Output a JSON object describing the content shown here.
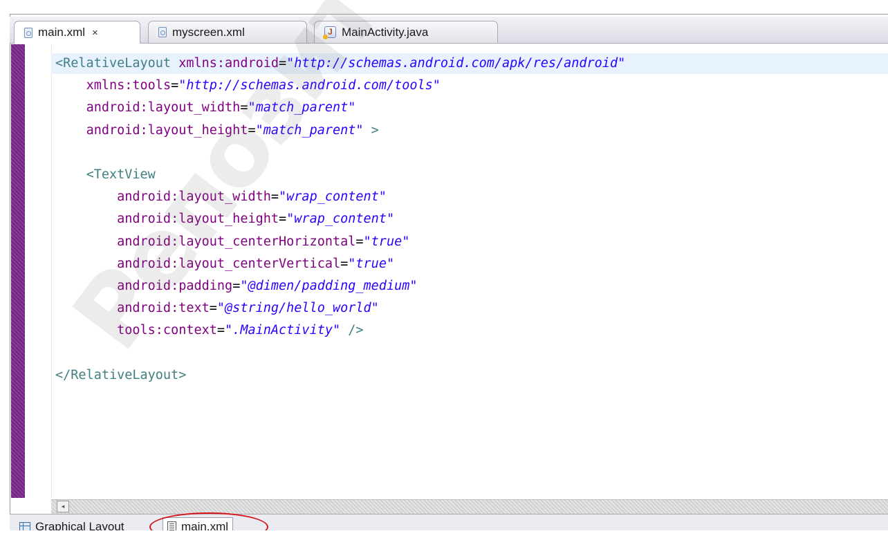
{
  "editor_tabs": [
    {
      "label": "main.xml",
      "icon": "xml-file-icon",
      "active": true,
      "close": "×"
    },
    {
      "label": "myscreen.xml",
      "icon": "xml-file-icon",
      "active": false
    },
    {
      "label": "MainActivity.java",
      "icon": "java-file-icon",
      "active": false
    }
  ],
  "code_lines": [
    [
      {
        "t": "tag",
        "v": "<RelativeLayout "
      },
      {
        "t": "attr",
        "v": "xmlns:android"
      },
      {
        "t": "eq",
        "v": "="
      },
      {
        "t": "val",
        "v": "\"http://schemas.android.com/apk/res/android\""
      }
    ],
    [
      {
        "t": "plain",
        "v": "    "
      },
      {
        "t": "attr",
        "v": "xmlns:tools"
      },
      {
        "t": "eq",
        "v": "="
      },
      {
        "t": "val",
        "v": "\"http://schemas.android.com/tools\""
      }
    ],
    [
      {
        "t": "plain",
        "v": "    "
      },
      {
        "t": "attr",
        "v": "android:layout_width"
      },
      {
        "t": "eq",
        "v": "="
      },
      {
        "t": "val",
        "v": "\"match_parent\""
      }
    ],
    [
      {
        "t": "plain",
        "v": "    "
      },
      {
        "t": "attr",
        "v": "android:layout_height"
      },
      {
        "t": "eq",
        "v": "="
      },
      {
        "t": "val",
        "v": "\"match_parent\""
      },
      {
        "t": "tag",
        "v": " >"
      }
    ],
    [],
    [
      {
        "t": "plain",
        "v": "    "
      },
      {
        "t": "tag",
        "v": "<TextView"
      }
    ],
    [
      {
        "t": "plain",
        "v": "        "
      },
      {
        "t": "attr",
        "v": "android:layout_width"
      },
      {
        "t": "eq",
        "v": "="
      },
      {
        "t": "val",
        "v": "\"wrap_content\""
      }
    ],
    [
      {
        "t": "plain",
        "v": "        "
      },
      {
        "t": "attr",
        "v": "android:layout_height"
      },
      {
        "t": "eq",
        "v": "="
      },
      {
        "t": "val",
        "v": "\"wrap_content\""
      }
    ],
    [
      {
        "t": "plain",
        "v": "        "
      },
      {
        "t": "attr",
        "v": "android:layout_centerHorizontal"
      },
      {
        "t": "eq",
        "v": "="
      },
      {
        "t": "val",
        "v": "\"true\""
      }
    ],
    [
      {
        "t": "plain",
        "v": "        "
      },
      {
        "t": "attr",
        "v": "android:layout_centerVertical"
      },
      {
        "t": "eq",
        "v": "="
      },
      {
        "t": "val",
        "v": "\"true\""
      }
    ],
    [
      {
        "t": "plain",
        "v": "        "
      },
      {
        "t": "attr",
        "v": "android:padding"
      },
      {
        "t": "eq",
        "v": "="
      },
      {
        "t": "val",
        "v": "\"@dimen/padding_medium\""
      }
    ],
    [
      {
        "t": "plain",
        "v": "        "
      },
      {
        "t": "attr",
        "v": "android:text"
      },
      {
        "t": "eq",
        "v": "="
      },
      {
        "t": "val",
        "v": "\"@string/hello_world\""
      }
    ],
    [
      {
        "t": "plain",
        "v": "        "
      },
      {
        "t": "attr",
        "v": "tools:context"
      },
      {
        "t": "eq",
        "v": "="
      },
      {
        "t": "val",
        "v": "\".MainActivity\""
      },
      {
        "t": "tag",
        "v": " />"
      }
    ],
    [],
    [
      {
        "t": "tag",
        "v": "</RelativeLayout>"
      }
    ]
  ],
  "scroll_left_glyph": "◂",
  "bottom_tabs": [
    {
      "label": "Graphical Layout",
      "icon": "graphical-layout-icon",
      "active": false
    },
    {
      "label": "main.xml",
      "icon": "xml-source-icon",
      "active": true
    }
  ],
  "annotation_color": "#d4161a",
  "colors": {
    "tag": "#3f7f7f",
    "attribute": "#7f007f",
    "value": "#2a00ff",
    "ruler": "#7d2f8f"
  }
}
